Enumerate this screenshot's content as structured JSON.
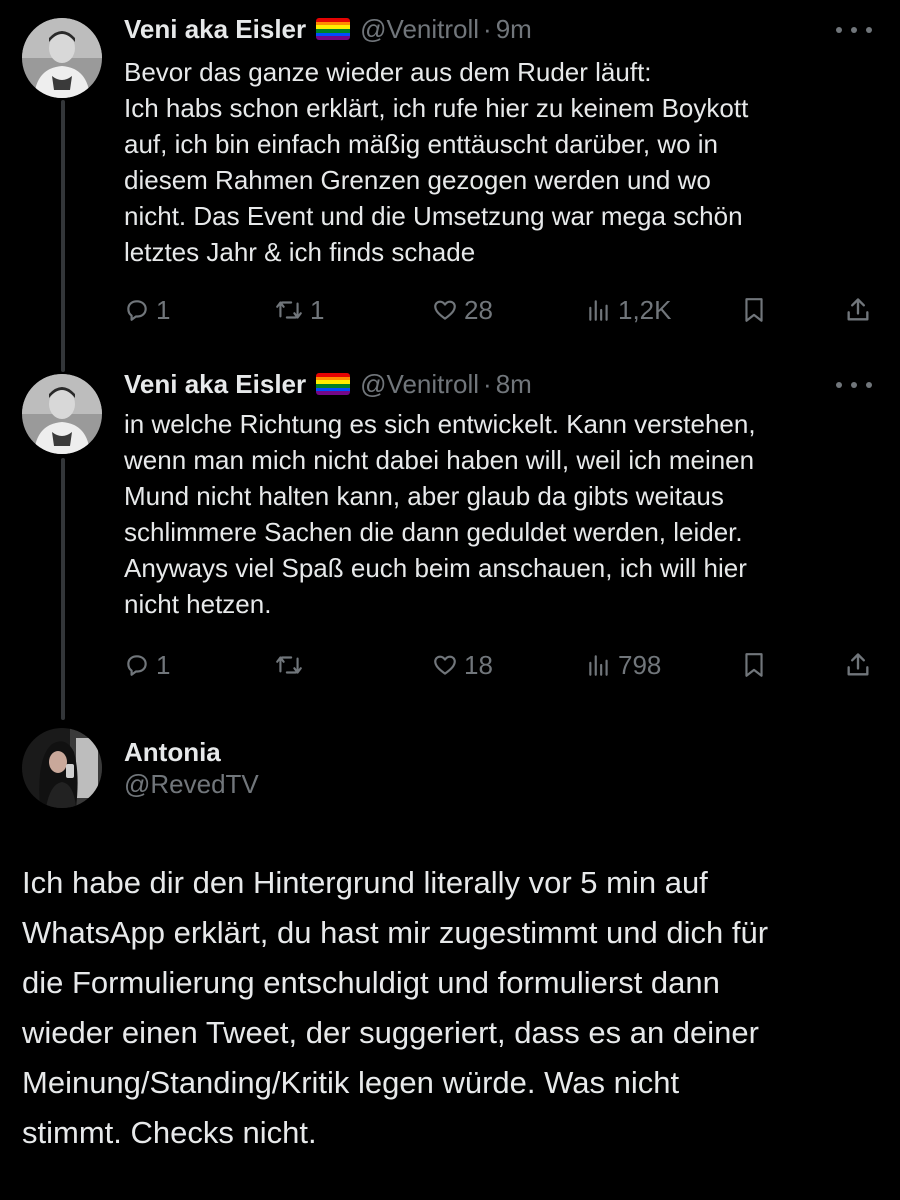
{
  "tweets": [
    {
      "display_name": "Veni aka Eisler",
      "handle": "@Venitroll",
      "separator": "·",
      "time": "9m",
      "lines": [
        "Bevor das ganze wieder aus dem Ruder läuft:",
        "Ich habs schon erklärt, ich rufe hier zu keinem Boykott",
        "auf, ich bin einfach mäßig enttäuscht darüber, wo in",
        "diesem Rahmen Grenzen gezogen werden und wo",
        "nicht. Das Event und die Umsetzung war mega schön",
        "letztes Jahr & ich finds schade"
      ],
      "replies": "1",
      "retweets": "1",
      "likes": "28",
      "views": "1,2K"
    },
    {
      "display_name": "Veni aka Eisler",
      "handle": "@Venitroll",
      "separator": "·",
      "time": "8m",
      "lines": [
        "in welche Richtung es sich entwickelt. Kann verstehen,",
        "wenn man mich nicht dabei haben will, weil ich meinen",
        "Mund nicht halten kann, aber glaub da gibts weitaus",
        "schlimmere Sachen die dann geduldet werden, leider.",
        "Anyways viel Spaß euch beim anschauen, ich will hier",
        "nicht hetzen."
      ],
      "replies": "1",
      "retweets": "",
      "likes": "18",
      "views": "798"
    }
  ],
  "reply": {
    "display_name": "Antonia",
    "handle": "@RevedTV",
    "lines": [
      "Ich habe dir den Hintergrund literally vor 5 min auf",
      "WhatsApp erklärt, du hast mir zugestimmt und dich für",
      "die Formulierung entschuldigt und formulierst dann",
      "wieder einen Tweet, der suggeriert, dass es an deiner",
      "Meinung/Standing/Kritik legen würde. Was nicht",
      "stimmt. Checks nicht."
    ]
  },
  "icons": {
    "flag": "rainbow-flag-emoji",
    "more": "more-icon",
    "reply": "reply-icon",
    "retweet": "retweet-icon",
    "like": "heart-icon",
    "views": "views-icon",
    "bookmark": "bookmark-icon",
    "share": "share-icon"
  },
  "colors": {
    "background": "#000000",
    "text": "#e7e9ea",
    "secondary": "#71767b",
    "thread_line": "#333639",
    "flag": [
      "#e40303",
      "#ff8c00",
      "#ffed00",
      "#008026",
      "#004dff",
      "#750787"
    ]
  }
}
